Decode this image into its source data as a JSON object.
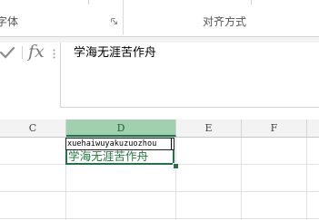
{
  "ribbon": {
    "font_group_label": "字体",
    "alignment_group_label": "对齐方式",
    "launcher_icon": "dialog-launcher-icon"
  },
  "formula_bar": {
    "cancel_icon": "checkmark-icon",
    "function_icon_text": "fx",
    "content": "学海无涯苦作舟"
  },
  "sheet": {
    "columns": [
      "C",
      "D",
      "E",
      "F"
    ],
    "active_column": "D",
    "active_cell": {
      "ime_composition": "xuehaiwuyakuzuozhou",
      "text": "学海无涯苦作舟"
    }
  },
  "colors": {
    "accent_green": "#217346",
    "header_selected": "#a0d0ae",
    "edit_text_green": "#1f7a3d"
  }
}
